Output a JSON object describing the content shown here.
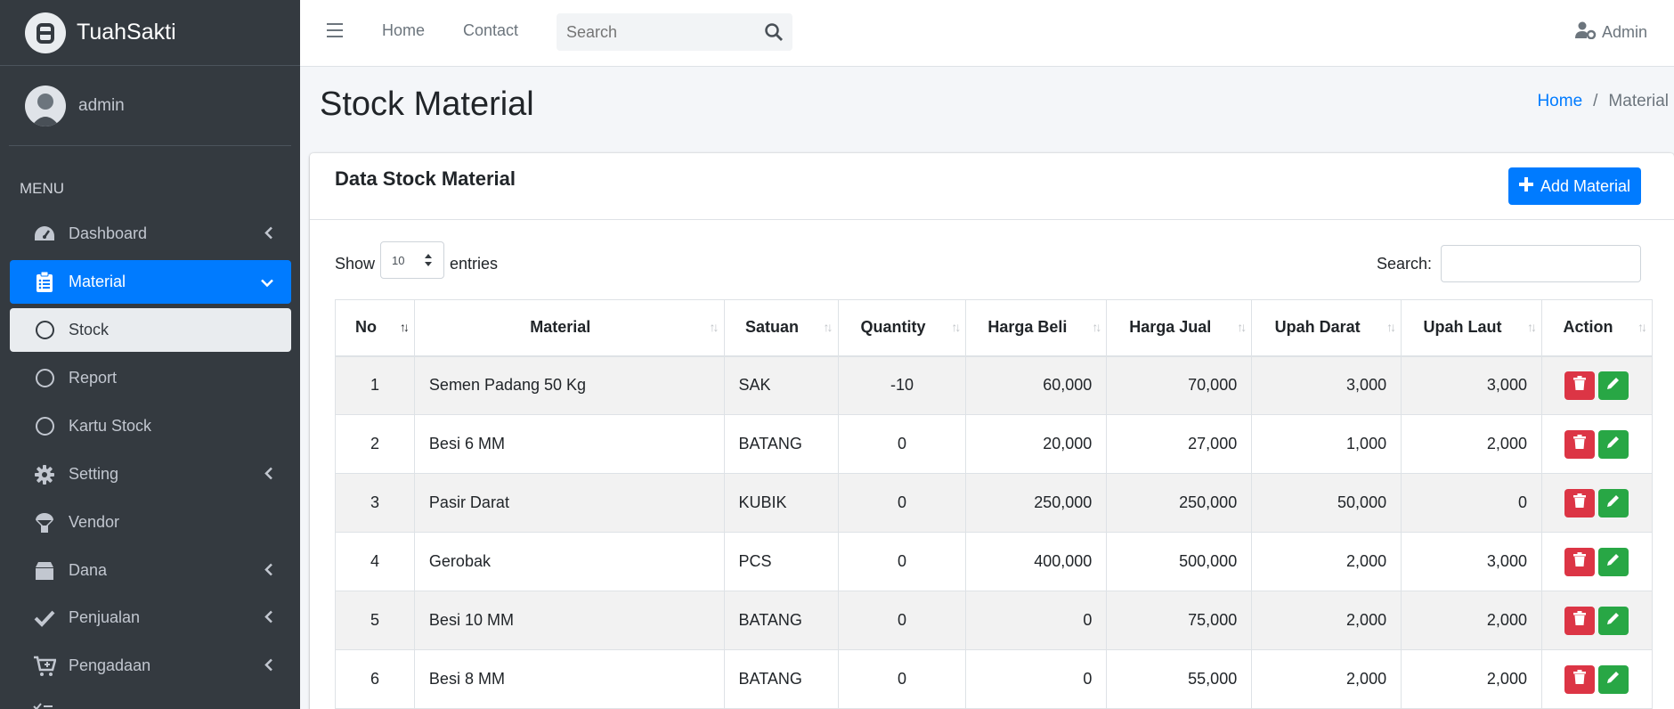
{
  "brand": {
    "name": "TuahSakti"
  },
  "user": {
    "name": "admin"
  },
  "menu": {
    "header": "MENU",
    "items": [
      {
        "label": "Dashboard"
      },
      {
        "label": "Material"
      },
      {
        "label": "Stock"
      },
      {
        "label": "Report"
      },
      {
        "label": "Kartu Stock"
      },
      {
        "label": "Setting"
      },
      {
        "label": "Vendor"
      },
      {
        "label": "Dana"
      },
      {
        "label": "Penjualan"
      },
      {
        "label": "Pengadaan"
      }
    ]
  },
  "navbar": {
    "links": [
      "Home",
      "Contact"
    ],
    "search_placeholder": "Search",
    "account": "Admin"
  },
  "page": {
    "title": "Stock Material"
  },
  "breadcrumb": {
    "home": "Home",
    "separator": "/",
    "current": "Material"
  },
  "card": {
    "title": "Data Stock Material",
    "add_button": "Add Material"
  },
  "datatable": {
    "show_label": "Show",
    "entries_value": "10",
    "entries_label": "entries",
    "search_label": "Search:",
    "columns": [
      "No",
      "Material",
      "Satuan",
      "Quantity",
      "Harga Beli",
      "Harga Jual",
      "Upah Darat",
      "Upah Laut",
      "Action"
    ],
    "rows": [
      {
        "no": "1",
        "material": "Semen Padang 50 Kg",
        "satuan": "SAK",
        "quantity": "-10",
        "harga_beli": "60,000",
        "harga_jual": "70,000",
        "upah_darat": "3,000",
        "upah_laut": "3,000"
      },
      {
        "no": "2",
        "material": "Besi 6 MM",
        "satuan": "BATANG",
        "quantity": "0",
        "harga_beli": "20,000",
        "harga_jual": "27,000",
        "upah_darat": "1,000",
        "upah_laut": "2,000"
      },
      {
        "no": "3",
        "material": "Pasir Darat",
        "satuan": "KUBIK",
        "quantity": "0",
        "harga_beli": "250,000",
        "harga_jual": "250,000",
        "upah_darat": "50,000",
        "upah_laut": "0"
      },
      {
        "no": "4",
        "material": "Gerobak",
        "satuan": "PCS",
        "quantity": "0",
        "harga_beli": "400,000",
        "harga_jual": "500,000",
        "upah_darat": "2,000",
        "upah_laut": "3,000"
      },
      {
        "no": "5",
        "material": "Besi 10 MM",
        "satuan": "BATANG",
        "quantity": "0",
        "harga_beli": "0",
        "harga_jual": "75,000",
        "upah_darat": "2,000",
        "upah_laut": "2,000"
      },
      {
        "no": "6",
        "material": "Besi 8 MM",
        "satuan": "BATANG",
        "quantity": "0",
        "harga_beli": "0",
        "harga_jual": "55,000",
        "upah_darat": "2,000",
        "upah_laut": "2,000"
      }
    ]
  },
  "colors": {
    "primary": "#007bff",
    "danger": "#dc3545",
    "success": "#28a745",
    "sidebar": "#343a40"
  }
}
